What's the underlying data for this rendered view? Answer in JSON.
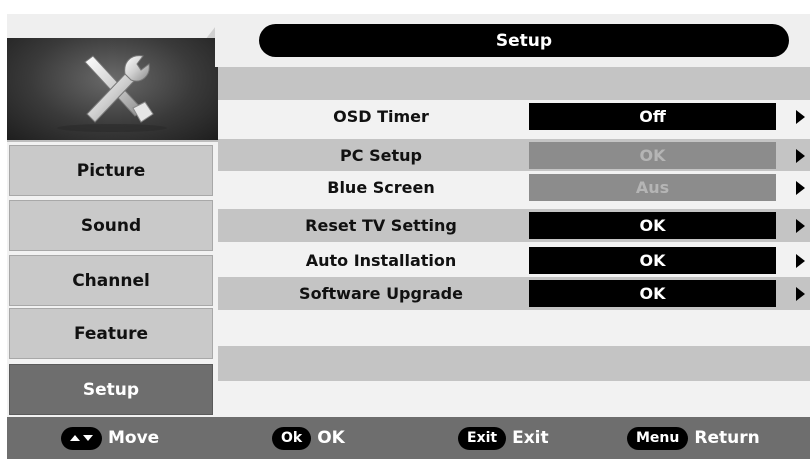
{
  "header": {
    "title": "Setup"
  },
  "sidebar": {
    "items": [
      {
        "label": "Picture"
      },
      {
        "label": "Sound"
      },
      {
        "label": "Channel"
      },
      {
        "label": "Feature"
      },
      {
        "label": "Setup",
        "active": true
      }
    ]
  },
  "rows": [
    {
      "label": "OSD Timer",
      "value": "Off",
      "enabled": true
    },
    {
      "label": "PC Setup",
      "value": "OK",
      "enabled": false
    },
    {
      "label": "Blue Screen",
      "value": "Aus",
      "enabled": false
    },
    {
      "label": "Reset TV Setting",
      "value": "OK",
      "enabled": true
    },
    {
      "label": "Auto Installation",
      "value": "OK",
      "enabled": true
    },
    {
      "label": "Software Upgrade",
      "value": "OK",
      "enabled": true
    }
  ],
  "footer": {
    "move_label": "Move",
    "ok_key": "Ok",
    "ok_label": "OK",
    "exit_key": "Exit",
    "exit_label": "Exit",
    "menu_key": "Menu",
    "return_label": "Return"
  },
  "icons": {
    "setup": "tools-icon"
  },
  "colors": {
    "active_tab": "#6e6e6e",
    "value_box": "#000000",
    "disabled_value": "#8c8c8c"
  }
}
